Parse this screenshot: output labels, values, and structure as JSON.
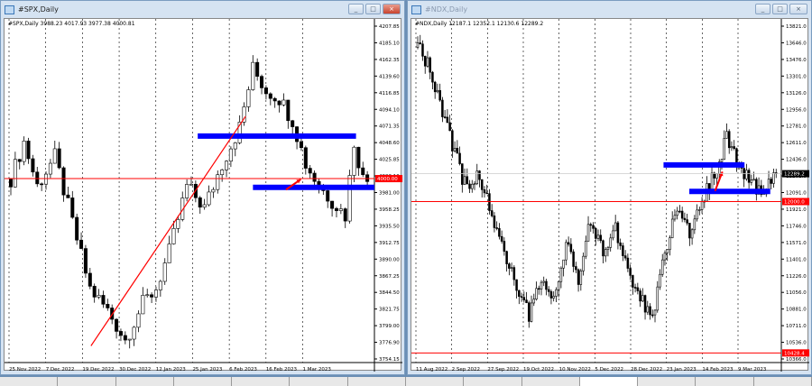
{
  "windows": [
    {
      "title": "#SPX,Daily",
      "info": "#SPX,Daily  3988.23 4017.93 3977.38 4000.81",
      "active": true,
      "price_labels": [
        "4207.85",
        "4185.10",
        "4162.35",
        "4139.60",
        "4116.85",
        "4094.10",
        "4071.35",
        "4048.60",
        "4025.85",
        "4003.10",
        "3981.00",
        "3958.25",
        "3935.50",
        "3912.75",
        "3890.00",
        "3867.25",
        "3844.50",
        "3821.75",
        "3799.00",
        "3776.90",
        "3754.15"
      ],
      "axis_max": 4207.85,
      "axis_min": 3754.15,
      "date_labels": [
        "25 Nov 2022",
        "7 Dec 2022",
        "19 Dec 2022",
        "30 Dec 2022",
        "12 Jan 2023",
        "25 Jan 2023",
        "6 Feb 2023",
        "16 Feb 2023",
        "1 Mar 2023"
      ],
      "red_levels": [
        {
          "price": 4000.0,
          "label": "4000.00"
        }
      ],
      "blue_levels": [
        {
          "price": 4058,
          "from": 0.52,
          "to": 0.95
        },
        {
          "price": 3988,
          "from": 0.67,
          "to": 1.0
        }
      ],
      "trendline": {
        "from": [
          0.23,
          3772
        ],
        "to": [
          0.65,
          4085
        ]
      },
      "arrow": {
        "from": [
          0.76,
          3985
        ],
        "to": [
          0.8,
          3999
        ]
      },
      "bars": 82,
      "close_anchors": [
        [
          0,
          4000
        ],
        [
          3,
          4050
        ],
        [
          6,
          3990
        ],
        [
          10,
          4030
        ],
        [
          14,
          3940
        ],
        [
          18,
          3850
        ],
        [
          22,
          3820
        ],
        [
          26,
          3780
        ],
        [
          30,
          3830
        ],
        [
          33,
          3850
        ],
        [
          36,
          3900
        ],
        [
          40,
          3990
        ],
        [
          44,
          3960
        ],
        [
          48,
          4020
        ],
        [
          52,
          4070
        ],
        [
          55,
          4150
        ],
        [
          58,
          4120
        ],
        [
          61,
          4110
        ],
        [
          64,
          4080
        ],
        [
          67,
          4020
        ],
        [
          70,
          3990
        ],
        [
          73,
          3970
        ],
        [
          76,
          3950
        ],
        [
          78,
          4050
        ],
        [
          80,
          4000
        ],
        [
          82,
          3995
        ]
      ]
    },
    {
      "title": "#NDX,Daily",
      "info": "#NDX,Daily  12187.1 12352.1 12130.6 12289.2",
      "active": false,
      "price_labels": [
        "13821.0",
        "13646.0",
        "13476.0",
        "13301.0",
        "13126.0",
        "12956.0",
        "12781.0",
        "12611.0",
        "12436.0",
        "12261.0",
        "12091.0",
        "11921.0",
        "11746.0",
        "11571.0",
        "11401.0",
        "11226.0",
        "11056.0",
        "10881.0",
        "10711.0",
        "10536.0",
        "10366.0"
      ],
      "axis_max": 13821,
      "axis_min": 10366,
      "date_labels": [
        "11 Aug 2022",
        "2 Sep 2022",
        "27 Sep 2022",
        "19 Oct 2022",
        "10 Nov 2022",
        "5 Dec 2022",
        "28 Dec 2022",
        "23 Jan 2023",
        "14 Feb 2023",
        "9 Mar 2023"
      ],
      "current_price": "12289.2",
      "red_levels": [
        {
          "price": 12000.0,
          "label": "12000.0"
        },
        {
          "price": 10428.4,
          "label": "10428.4"
        }
      ],
      "blue_levels": [
        {
          "price": 12380,
          "from": 0.68,
          "to": 0.9
        },
        {
          "price": 12105,
          "from": 0.75,
          "to": 0.97
        }
      ],
      "arrow": {
        "from": [
          0.82,
          12110
        ],
        "to": [
          0.84,
          12310
        ]
      },
      "bars": 146,
      "close_anchors": [
        [
          0,
          13600
        ],
        [
          5,
          13400
        ],
        [
          10,
          12900
        ],
        [
          15,
          12500
        ],
        [
          20,
          12100
        ],
        [
          25,
          12300
        ],
        [
          30,
          11800
        ],
        [
          38,
          11300
        ],
        [
          45,
          10800
        ],
        [
          50,
          11200
        ],
        [
          55,
          11000
        ],
        [
          60,
          11600
        ],
        [
          65,
          11200
        ],
        [
          70,
          11800
        ],
        [
          75,
          11500
        ],
        [
          80,
          11700
        ],
        [
          85,
          11300
        ],
        [
          90,
          11000
        ],
        [
          95,
          10800
        ],
        [
          100,
          11500
        ],
        [
          105,
          11900
        ],
        [
          110,
          11700
        ],
        [
          115,
          12000
        ],
        [
          120,
          12300
        ],
        [
          125,
          12650
        ],
        [
          130,
          12400
        ],
        [
          135,
          12200
        ],
        [
          140,
          12000
        ],
        [
          144,
          12300
        ],
        [
          146,
          12289
        ]
      ]
    }
  ],
  "colors": {
    "red": "#ff0000",
    "blue": "#0000ff",
    "candle": "#000000"
  }
}
